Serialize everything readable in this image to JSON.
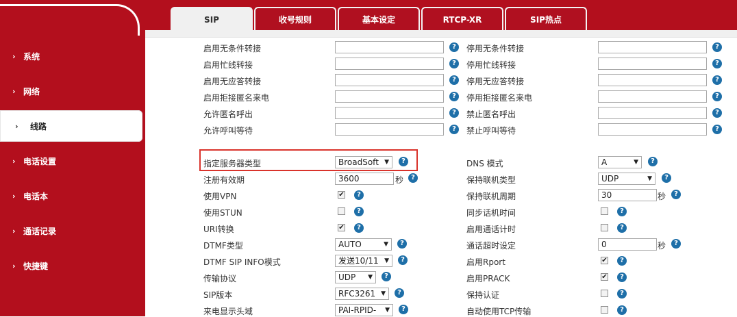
{
  "sidebar": {
    "items": [
      {
        "label": "系统"
      },
      {
        "label": "网络"
      },
      {
        "label": "线路"
      },
      {
        "label": "电话设置"
      },
      {
        "label": "电话本"
      },
      {
        "label": "通话记录"
      },
      {
        "label": "快捷键"
      }
    ]
  },
  "tabs": [
    {
      "label": "SIP"
    },
    {
      "label": "收号规则"
    },
    {
      "label": "基本设定"
    },
    {
      "label": "RTCP-XR"
    },
    {
      "label": "SIP热点"
    }
  ],
  "forward": {
    "rows": [
      {
        "left": "启用无条件转接",
        "right": "停用无条件转接"
      },
      {
        "left": "启用忙线转接",
        "right": "停用忙线转接"
      },
      {
        "left": "启用无应答转接",
        "right": "停用无应答转接"
      },
      {
        "left": "启用拒接匿名来电",
        "right": "停用拒接匿名来电"
      },
      {
        "left": "允许匿名呼出",
        "right": "禁止匿名呼出"
      },
      {
        "left": "允许呼叫等待",
        "right": "禁止呼叫等待"
      }
    ]
  },
  "left": {
    "server_type": {
      "label": "指定服务器类型",
      "value": "BroadSoft"
    },
    "reg_expiry": {
      "label": "注册有效期",
      "value": "3600",
      "unit": "秒"
    },
    "use_vpn": {
      "label": "使用VPN"
    },
    "use_stun": {
      "label": "使用STUN"
    },
    "uri_convert": {
      "label": "URI转换"
    },
    "dtmf_type": {
      "label": "DTMF类型",
      "value": "AUTO"
    },
    "dtmf_sip_info": {
      "label": "DTMF SIP INFO模式",
      "value": "发送10/11"
    },
    "transport": {
      "label": "传输协议",
      "value": "UDP"
    },
    "sip_version": {
      "label": "SIP版本",
      "value": "RFC3261"
    },
    "caller_id_header": {
      "label": "来电显示头域",
      "value": "PAI-RPID-"
    }
  },
  "right": {
    "dns_mode": {
      "label": "DNS 模式",
      "value": "A"
    },
    "keepalive_type": {
      "label": "保持联机类型",
      "value": "UDP"
    },
    "keepalive_period": {
      "label": "保持联机周期",
      "value": "30",
      "unit": "秒"
    },
    "sync_time": {
      "label": "同步话机时间"
    },
    "call_timer": {
      "label": "启用通话计时"
    },
    "call_timeout": {
      "label": "通话超时设定",
      "value": "0",
      "unit": "秒"
    },
    "rport": {
      "label": "启用Rport"
    },
    "prack": {
      "label": "启用PRACK"
    },
    "keep_auth": {
      "label": "保持认证"
    },
    "auto_tcp": {
      "label": "自动使用TCP传输"
    }
  },
  "glyphs": {
    "help": "?",
    "check": "✔",
    "caret": "▼",
    "arrow": "›"
  }
}
